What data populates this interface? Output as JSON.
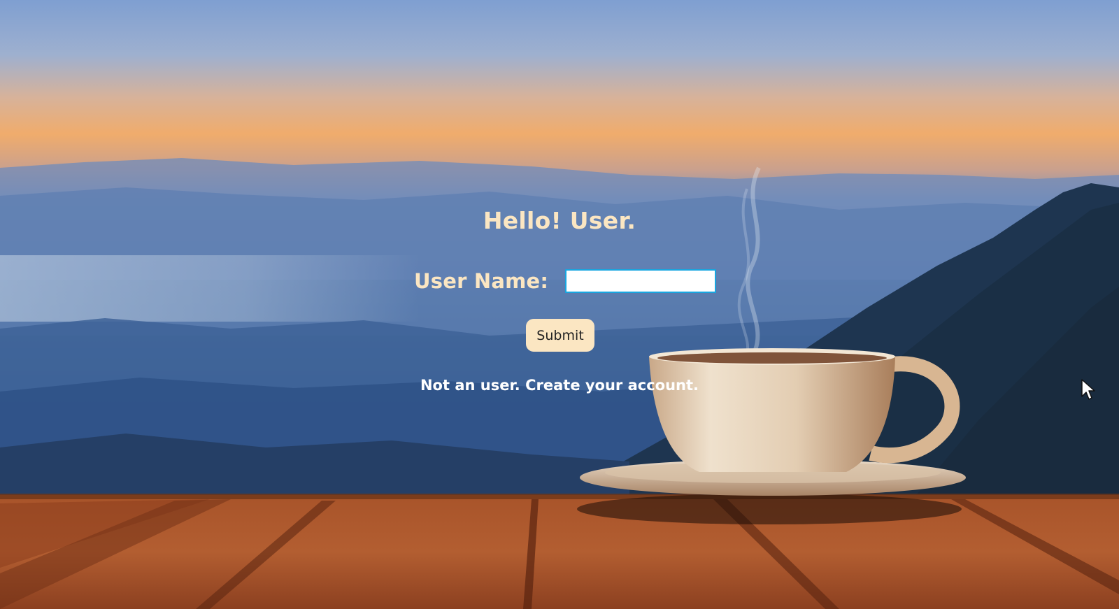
{
  "greeting": "Hello! User.",
  "form": {
    "username_label": "User Name:",
    "username_value": "",
    "submit_label": "Submit",
    "create_account_text": "Not an user. Create your account."
  },
  "background": {
    "scene": "mountain sunrise with coffee cup on wooden table",
    "icons": [
      "coffee-cup-icon",
      "mouse-pointer-icon"
    ]
  },
  "colors": {
    "heading_text": "#fbe6c2",
    "link_text": "#ffffff",
    "button_bg": "#fbe6c2",
    "input_border": "#18a6e0",
    "wood": "#9e4a1f",
    "sky_top": "#7f9fd1",
    "sky_glow": "#f0a868"
  }
}
